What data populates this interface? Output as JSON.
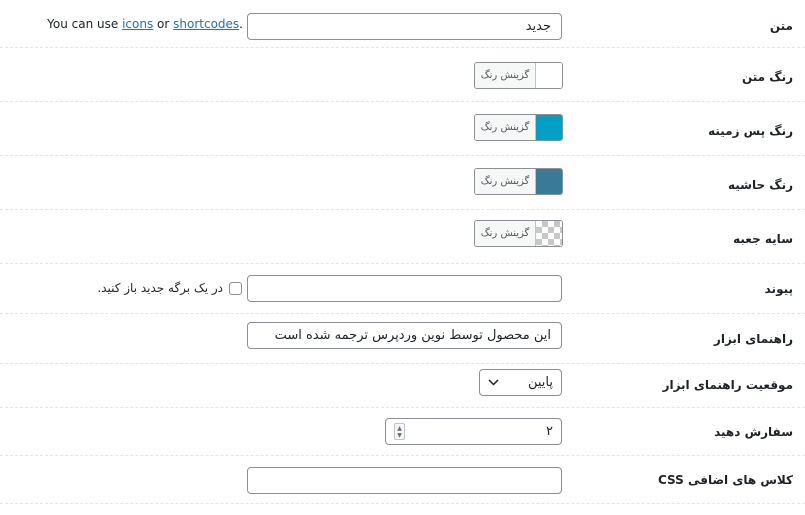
{
  "fields": {
    "text": {
      "label": "متن",
      "value": "جدید",
      "hint_prefix": "You can use ",
      "hint_link1": "icons",
      "hint_or": " or ",
      "hint_link2": "shortcodes",
      "hint_suffix": "."
    },
    "text_color": {
      "label": "رنگ متن",
      "button": "گزینش رنگ",
      "color": "#ffffff"
    },
    "background_color": {
      "label": "رنگ پس زمینه",
      "button": "گزینش رنگ",
      "color": "#00a0c4"
    },
    "border_color": {
      "label": "رنگ حاشیه",
      "button": "گزینش رنگ",
      "color": "#387a97"
    },
    "box_shadow": {
      "label": "سایه جعبه",
      "button": "گزینش رنگ",
      "color": "transparent"
    },
    "link": {
      "label": "پیوند",
      "value": "",
      "checkbox_label": "در یک برگه جدید باز کنید."
    },
    "tooltip": {
      "label": "راهنمای ابزار",
      "value": "این محصول توسط نوین وردپرس ترجمه شده است"
    },
    "tooltip_position": {
      "label": "موقعیت راهنمای ابزار",
      "selected": "پایین"
    },
    "order": {
      "label": "سفارش دهید",
      "value": "۲"
    },
    "css_class": {
      "label": "کلاس های اضافی CSS",
      "value": ""
    }
  }
}
